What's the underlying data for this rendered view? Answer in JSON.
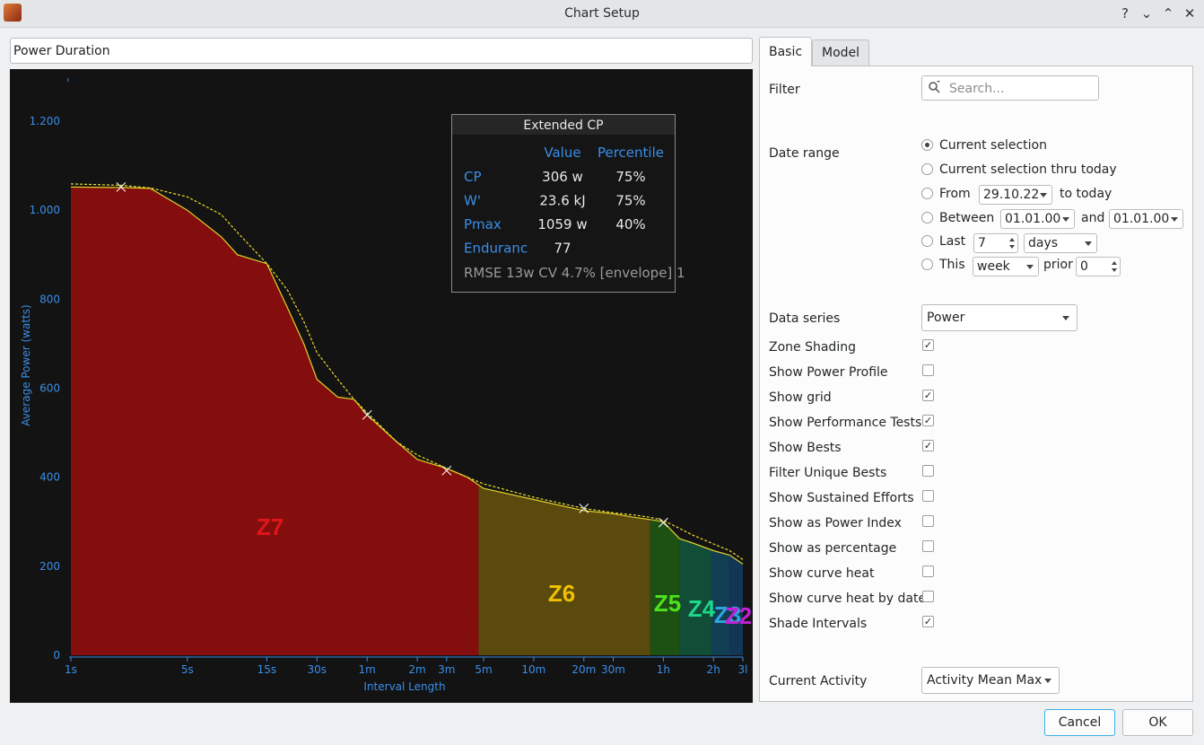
{
  "window": {
    "title": "Chart Setup"
  },
  "chart_name": "Power Duration",
  "chart_data": {
    "type": "area",
    "xlabel": "Interval Length",
    "ylabel": "Average Power (watts)",
    "ylim": [
      0,
      1200
    ],
    "y_ticks": [
      "0",
      "200",
      "400",
      "600",
      "800",
      "1.000",
      "1.200"
    ],
    "x_ticks": [
      "1s",
      "5s",
      "15s",
      "30s",
      "1m",
      "2m",
      "3m",
      "5m",
      "10m",
      "20m",
      "30m",
      "1h",
      "2h",
      "3l"
    ],
    "x_tick_seconds": [
      1,
      5,
      15,
      30,
      60,
      120,
      180,
      300,
      600,
      1200,
      1800,
      3600,
      7200,
      10800
    ],
    "grid": false,
    "series": [
      {
        "values_x_seconds": [
          1,
          2,
          3,
          5,
          8,
          10,
          15,
          20,
          25,
          30,
          40,
          50,
          60,
          90,
          120,
          180,
          240,
          300,
          600,
          1200,
          1800,
          2400,
          3000,
          3600,
          4500,
          5400,
          7200,
          9000,
          10800
        ],
        "values": [
          1052,
          1051,
          1049,
          1000,
          940,
          900,
          880,
          780,
          700,
          620,
          580,
          575,
          540,
          480,
          440,
          420,
          400,
          375,
          350,
          325,
          318,
          310,
          305,
          300,
          262,
          252,
          235,
          225,
          205
        ]
      },
      {
        "name": "Extended CP",
        "values_x_seconds": [
          1,
          2,
          3,
          5,
          8,
          10,
          15,
          20,
          25,
          30,
          40,
          50,
          60,
          90,
          120,
          180,
          240,
          300,
          600,
          1200,
          1800,
          2400,
          3000,
          3600,
          4500,
          5400,
          7200,
          9000,
          10800
        ],
        "values": [
          1059,
          1056,
          1050,
          1030,
          990,
          950,
          880,
          820,
          750,
          680,
          620,
          575,
          545,
          480,
          450,
          420,
          400,
          385,
          355,
          330,
          320,
          315,
          310,
          303,
          285,
          270,
          250,
          235,
          215
        ]
      }
    ],
    "test_markers": [
      {
        "x_seconds": 2,
        "y": 1052
      },
      {
        "x_seconds": 60,
        "y": 540
      },
      {
        "x_seconds": 180,
        "y": 415
      },
      {
        "x_seconds": 1200,
        "y": 330
      },
      {
        "x_seconds": 3600,
        "y": 298
      }
    ],
    "zones": [
      {
        "label": "Z7",
        "from_seconds": 1,
        "to_seconds": 280,
        "color": "#8a0e0e",
        "label_color": "#e0151a"
      },
      {
        "label": "Z6",
        "from_seconds": 280,
        "to_seconds": 3000,
        "color": "#5f4d0d",
        "label_color": "#f0c000"
      },
      {
        "label": "Z5",
        "from_seconds": 3000,
        "to_seconds": 4500,
        "color": "#1e5414",
        "label_color": "#4ee11d"
      },
      {
        "label": "Z4",
        "from_seconds": 4500,
        "to_seconds": 7000,
        "color": "#12503a",
        "label_color": "#1bd88a"
      },
      {
        "label": "Z3",
        "from_seconds": 7000,
        "to_seconds": 9000,
        "color": "#114055",
        "label_color": "#2aa6e0"
      },
      {
        "label": "Z2",
        "from_seconds": 9000,
        "to_seconds": 10800,
        "color": "#14385a",
        "label_color": "#c21fd6"
      }
    ],
    "legend": {
      "title": "Extended CP",
      "headers": [
        "Value",
        "Percentile"
      ],
      "rows": [
        {
          "name": "CP",
          "value": "306 w",
          "percentile": "75%"
        },
        {
          "name": "W'",
          "value": "23.6 kJ",
          "percentile": "75%"
        },
        {
          "name": "Pmax",
          "value": "1059 w",
          "percentile": "40%"
        },
        {
          "name": "Enduranc",
          "value": "77",
          "percentile": ""
        }
      ],
      "footer": "RMSE 13w CV 4.7% [envelope] 1",
      "placement": "top-right"
    }
  },
  "tabs": [
    {
      "label": "Basic"
    },
    {
      "label": "Model"
    }
  ],
  "filter": {
    "label": "Filter",
    "placeholder": "Search..."
  },
  "date_range": {
    "label": "Date range",
    "opt_current": "Current selection",
    "opt_thru_today": "Current selection thru today",
    "from_label": "From",
    "from_date": "29.10.22",
    "to_today": "to today",
    "between_label": "Between",
    "between_start": "01.01.00",
    "and_label": "and",
    "between_end": "01.01.00",
    "last_label": "Last",
    "last_value": "7",
    "last_unit": "days",
    "this_label": "This",
    "this_unit": "week",
    "prior_label": "prior",
    "prior_value": "0",
    "selected": "current"
  },
  "data_series": {
    "label": "Data series",
    "value": "Power"
  },
  "options": [
    {
      "label": "Zone Shading",
      "checked": true
    },
    {
      "label": "Show Power Profile",
      "checked": false
    },
    {
      "label": "Show grid",
      "checked": true
    },
    {
      "label": "Show Performance Tests",
      "checked": true
    },
    {
      "label": "Show Bests",
      "checked": true
    },
    {
      "label": "Filter Unique Bests",
      "checked": false
    },
    {
      "label": "Show Sustained Efforts",
      "checked": false
    },
    {
      "label": "Show as Power Index",
      "checked": false
    },
    {
      "label": "Show as percentage",
      "checked": false
    },
    {
      "label": "Show curve heat",
      "checked": false
    },
    {
      "label": "Show curve heat by date",
      "checked": false
    },
    {
      "label": "Shade Intervals",
      "checked": true
    }
  ],
  "current_activity": {
    "label": "Current Activity",
    "value": "Activity Mean Max"
  },
  "buttons": {
    "cancel": "Cancel",
    "ok": "OK"
  }
}
